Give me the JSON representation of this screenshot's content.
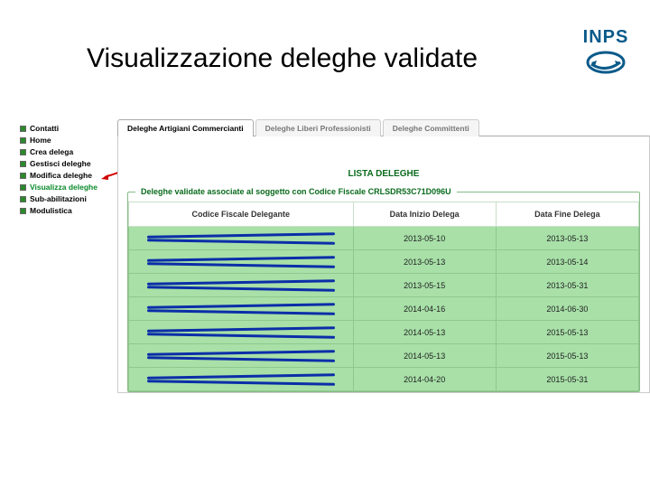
{
  "slide": {
    "title": "Visualizzazione deleghe validate"
  },
  "logo": {
    "text": "INPS"
  },
  "sidebar": {
    "items": [
      {
        "label": "Contatti"
      },
      {
        "label": "Home"
      },
      {
        "label": "Crea delega"
      },
      {
        "label": "Gestisci deleghe"
      },
      {
        "label": "Modifica deleghe"
      },
      {
        "label": "Visualizza deleghe",
        "highlight": true
      },
      {
        "label": "Sub-abilitazioni"
      },
      {
        "label": "Modulistica"
      }
    ]
  },
  "tabs": [
    {
      "label": "Deleghe Artigiani Commercianti",
      "active": true
    },
    {
      "label": "Deleghe Liberi Professionisti",
      "active": false
    },
    {
      "label": "Deleghe Committenti",
      "active": false
    }
  ],
  "panel": {
    "lista_title": "LISTA DELEGHE",
    "fieldset_legend": "Deleghe validate associate al soggetto con Codice Fiscale CRLSDR53C71D096U",
    "columns": [
      "Codice Fiscale Delegante",
      "Data Inizio Delega",
      "Data Fine Delega"
    ],
    "rows": [
      {
        "cf": "████",
        "inizio": "2013-05-10",
        "fine": "2013-05-13"
      },
      {
        "cf": "████",
        "inizio": "2013-05-13",
        "fine": "2013-05-14"
      },
      {
        "cf": "████",
        "inizio": "2013-05-15",
        "fine": "2013-05-31"
      },
      {
        "cf": "████",
        "inizio": "2014-04-16",
        "fine": "2014-06-30"
      },
      {
        "cf": "████",
        "inizio": "2014-05-13",
        "fine": "2015-05-13"
      },
      {
        "cf": "████",
        "inizio": "2014-05-13",
        "fine": "2015-05-13"
      },
      {
        "cf": "████",
        "inizio": "2014-04-20",
        "fine": "2015-05-31"
      }
    ]
  }
}
